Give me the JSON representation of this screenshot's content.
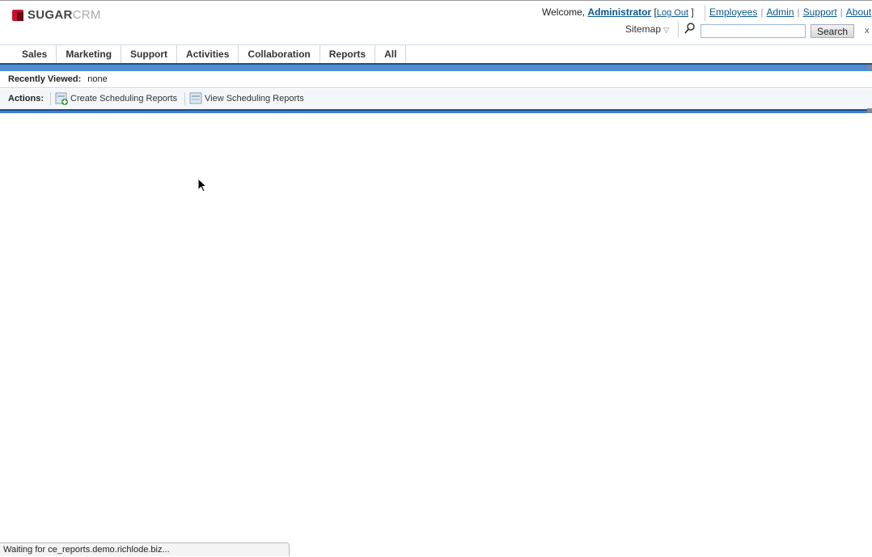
{
  "brand": {
    "logo_text_bold": "SUGAR",
    "logo_text_light": "CRM"
  },
  "header": {
    "welcome_prefix": "Welcome,",
    "user_name": "Administrator",
    "logout_open": "[",
    "logout_label": "Log Out",
    "logout_close": "]",
    "top_links": [
      "Employees",
      "Admin",
      "Support",
      "About"
    ],
    "sitemap_label": "Sitemap",
    "search_value": "",
    "search_button": "Search",
    "close_glyph": "x"
  },
  "nav": {
    "tabs": [
      "Sales",
      "Marketing",
      "Support",
      "Activities",
      "Collaboration",
      "Reports",
      "All"
    ]
  },
  "recently_viewed": {
    "label": "Recently Viewed:",
    "value": "none"
  },
  "actions": {
    "label": "Actions:",
    "items": [
      "Create Scheduling Reports",
      "View Scheduling Reports"
    ]
  },
  "status_bar": {
    "text": "Waiting for ce_reports.demo.richlode.biz..."
  },
  "colors": {
    "link": "#0b578f",
    "nav_bar_blue": "#4e8dd0",
    "logo_red": "#c8102e"
  },
  "icons": [
    "search-icon",
    "sitemap-dropdown-icon",
    "close-icon",
    "create-report-icon",
    "view-report-icon",
    "mouse-cursor-icon"
  ]
}
